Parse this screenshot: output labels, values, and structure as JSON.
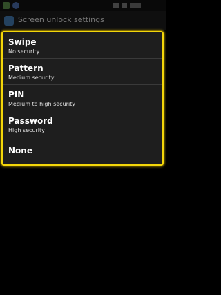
{
  "title_bar": {
    "title": "Screen unlock settings"
  },
  "options": [
    {
      "label": "Swipe",
      "sub": "No security"
    },
    {
      "label": "Pattern",
      "sub": "Medium security"
    },
    {
      "label": "PIN",
      "sub": "Medium to high security"
    },
    {
      "label": "Password",
      "sub": "High security"
    },
    {
      "label": "None",
      "sub": ""
    }
  ],
  "colors": {
    "highlight_border": "#f3d60a",
    "dialog_bg": "#1e1e1e",
    "background": "#000000"
  }
}
